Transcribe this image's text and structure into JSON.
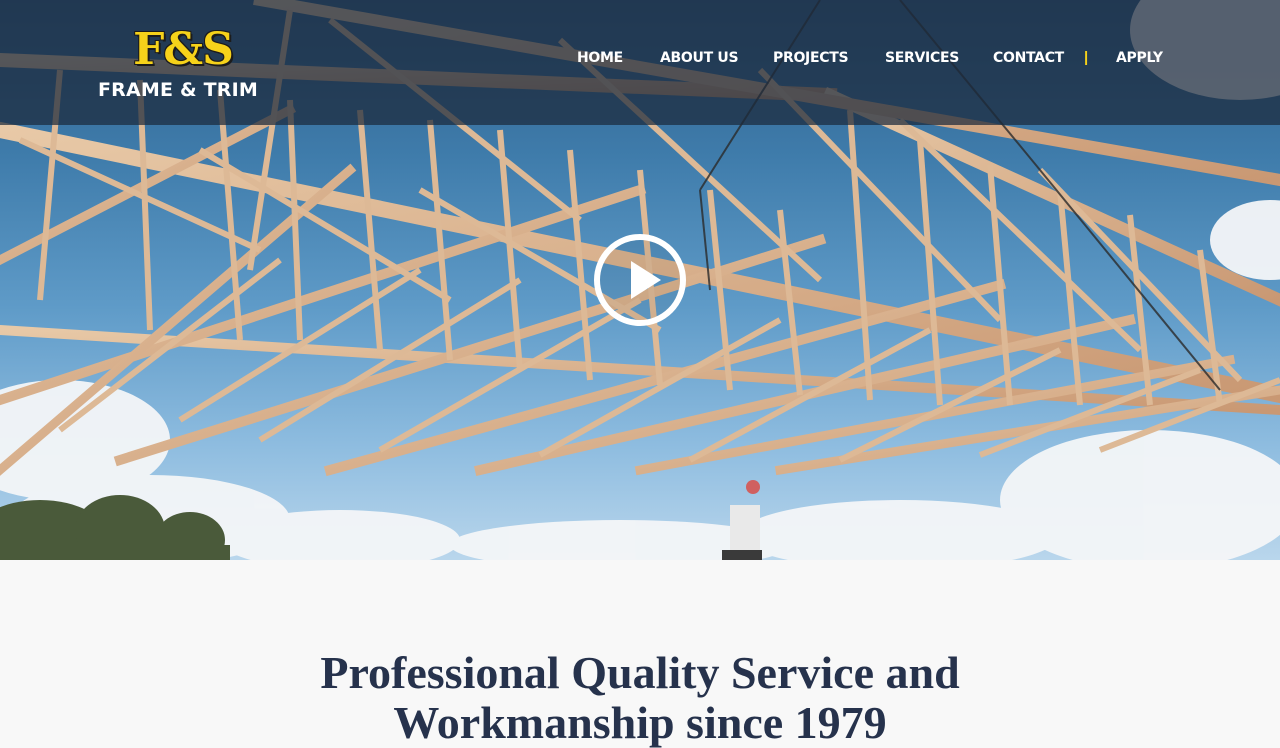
{
  "brand": {
    "logo_mark": "F&S",
    "logo_sub": "FRAME & TRIM",
    "colors": {
      "accent": "#f6d21a",
      "nav_bg": "#1c2a3c",
      "headline": "#26324c"
    }
  },
  "nav": {
    "items": [
      {
        "label": "HOME"
      },
      {
        "label": "ABOUT US"
      },
      {
        "label": "PROJECTS"
      },
      {
        "label": "SERVICES"
      },
      {
        "label": "CONTACT"
      },
      {
        "label": "APPLY"
      }
    ],
    "separator": "|"
  },
  "hero": {
    "play_icon": "play-icon"
  },
  "main": {
    "headline_line1": "Professional Quality Service and",
    "headline_line2": "Workmanship since 1979"
  }
}
